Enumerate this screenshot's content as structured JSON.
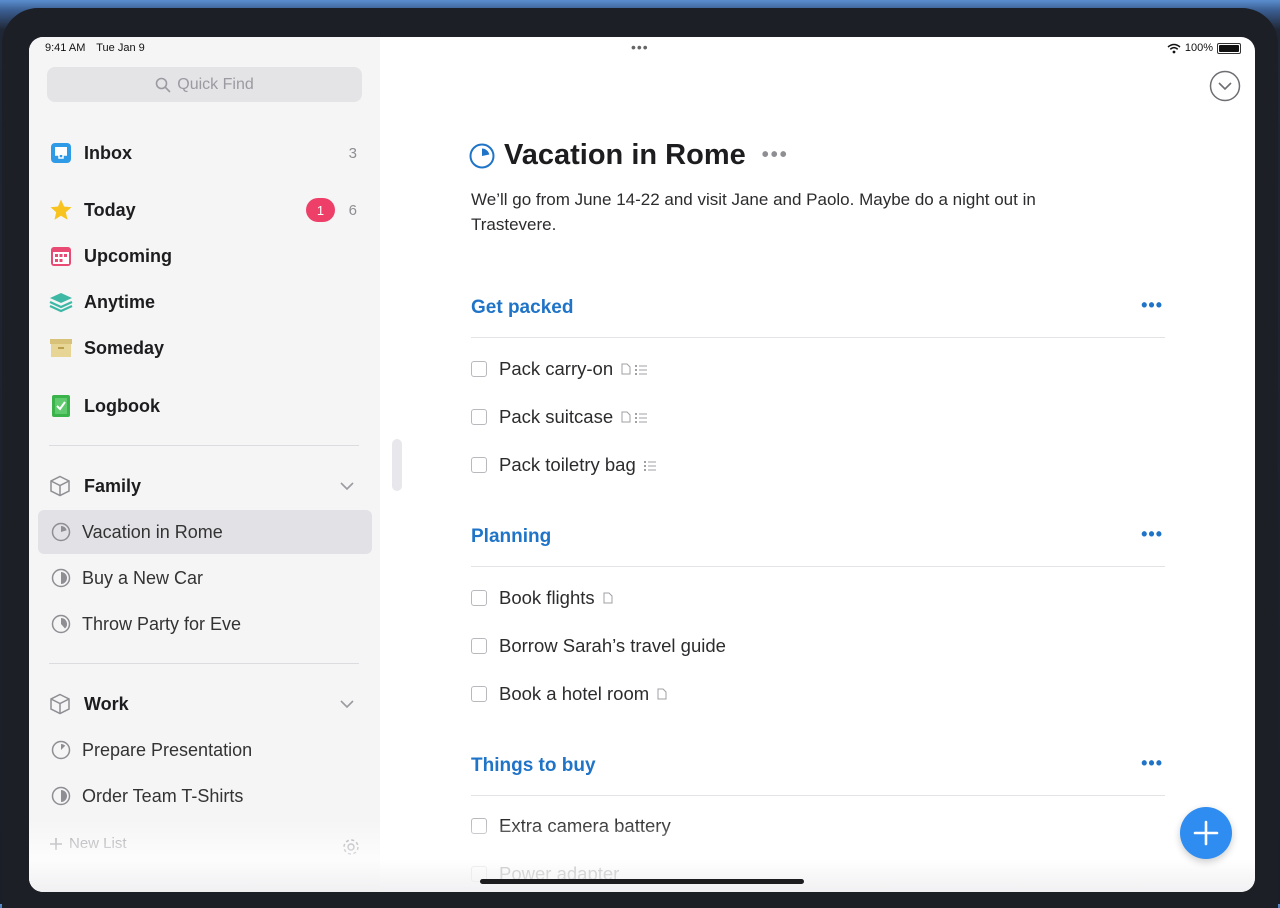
{
  "status_bar": {
    "time": "9:41 AM",
    "date": "Tue Jan 9",
    "battery": "100%"
  },
  "sidebar": {
    "search_placeholder": "Quick Find",
    "nav": [
      {
        "label": "Inbox",
        "count": "3",
        "icon": "inbox-icon"
      },
      {
        "label": "Today",
        "badge": "1",
        "count": "6",
        "icon": "star-icon"
      },
      {
        "label": "Upcoming",
        "icon": "calendar-icon"
      },
      {
        "label": "Anytime",
        "icon": "layers-icon"
      },
      {
        "label": "Someday",
        "icon": "archive-box-icon"
      },
      {
        "label": "Logbook",
        "icon": "logbook-icon"
      }
    ],
    "areas": [
      {
        "label": "Family",
        "projects": [
          "Vacation in Rome",
          "Buy a New Car",
          "Throw Party for Eve"
        ]
      },
      {
        "label": "Work",
        "projects": [
          "Prepare Presentation",
          "Order Team T-Shirts"
        ]
      }
    ],
    "selected_project": "Vacation in Rome",
    "new_list_label": "New List"
  },
  "project": {
    "title": "Vacation in Rome",
    "notes": "We’ll go from June 14-22 and visit Jane and Paolo. Maybe do a night out in Trastevere.",
    "headings": [
      {
        "title": "Get packed",
        "todos": [
          {
            "text": "Pack carry-on",
            "note": true,
            "checklist": true
          },
          {
            "text": "Pack suitcase",
            "note": true,
            "checklist": true
          },
          {
            "text": "Pack toiletry bag",
            "note": false,
            "checklist": true
          }
        ]
      },
      {
        "title": "Planning",
        "todos": [
          {
            "text": "Book flights",
            "note": true,
            "checklist": false
          },
          {
            "text": "Borrow Sarah’s travel guide",
            "note": false,
            "checklist": false
          },
          {
            "text": "Book a hotel room",
            "note": true,
            "checklist": false
          }
        ]
      },
      {
        "title": "Things to buy",
        "todos": [
          {
            "text": "Extra camera battery",
            "note": false,
            "checklist": false
          },
          {
            "text": "Power adapter",
            "note": false,
            "checklist": false
          }
        ]
      }
    ]
  },
  "colors": {
    "accent": "#1f74c8",
    "badge": "#ee3f68",
    "fab": "#2f8cf0"
  }
}
